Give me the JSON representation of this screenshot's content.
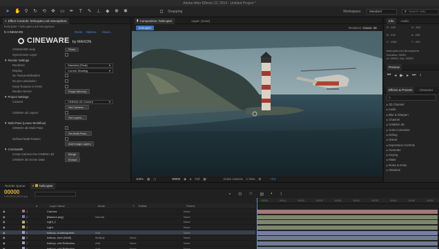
{
  "app": {
    "title": "Adobe After Effects CC 2014 - Untitled Project *"
  },
  "toolbar": {
    "tools": [
      "selection-tool-icon",
      "hand-tool-icon",
      "zoom-tool-icon",
      "rotate-tool-icon",
      "camera-orbit-icon",
      "pan-behind-icon",
      "rectangle-tool-icon",
      "pen-tool-icon",
      "text-tool-icon",
      "brush-tool-icon",
      "clone-stamp-icon",
      "eraser-tool-icon",
      "roto-brush-icon",
      "puppet-pin-icon"
    ],
    "snapping_label": "Snapping",
    "workspace_label": "Workspace:",
    "workspace_value": "Standard",
    "search_placeholder": "Search Help"
  },
  "effects_panel": {
    "tab_label": "Effect Controls: helicopter.c4d Atmosphere",
    "breadcrumb": "helicopter • helicopter.c4d Atmosphere",
    "effect_name": "fx CINEWARE",
    "reset_label": "Reset",
    "options_label": "Options...",
    "about_label": "About...",
    "logo_text": "CINEWARE",
    "logo_by": "by MAXON",
    "rows": [
      {
        "label": "CINEWARE Help",
        "control": "button",
        "value": "Show"
      },
      {
        "label": "Synchronize Layer",
        "control": "check",
        "value": ""
      },
      {
        "label": "▼ Render Settings",
        "control": "none",
        "value": ""
      },
      {
        "label": "Renderer",
        "control": "dropdown",
        "value": "Standard (Final)"
      },
      {
        "label": "Display",
        "control": "dropdown",
        "value": "Current Shading"
      },
      {
        "label": "No Textures/Shaders",
        "control": "check",
        "value": ""
      },
      {
        "label": "No pre-calculation",
        "control": "check",
        "value": ""
      },
      {
        "label": "Keep Textures in RAM",
        "control": "check",
        "value": ""
      },
      {
        "label": "Render Server",
        "control": "button",
        "value": "Purge Memory"
      },
      {
        "label": "▼ Project Settings",
        "control": "none",
        "value": ""
      },
      {
        "label": "Camera",
        "control": "dropdown",
        "value": "CINEMA 4D Camera"
      },
      {
        "label": "",
        "control": "button",
        "value": "Set Camera..."
      },
      {
        "label": "CINEMA 4D Layers",
        "control": "check",
        "value": ""
      },
      {
        "label": "",
        "control": "button",
        "value": "Set Layers..."
      },
      {
        "label": "▼ Multi-Pass (Linear Workflow)",
        "control": "none",
        "value": ""
      },
      {
        "label": "CINEMA 4D Multi-Pass",
        "control": "check",
        "value": ""
      },
      {
        "label": "",
        "control": "button",
        "value": "Set Multi-Pass..."
      },
      {
        "label": "Defined Multi-Passes",
        "control": "check",
        "value": ""
      },
      {
        "label": "",
        "control": "button",
        "value": "Add Image Layers"
      },
      {
        "label": "▼ Commands",
        "control": "none",
        "value": ""
      },
      {
        "label": "Comp Camera into CINEMA 4D",
        "control": "button",
        "value": "Merge"
      },
      {
        "label": "CINEMA 4D Scene Data",
        "control": "button",
        "value": "Extract"
      }
    ]
  },
  "comp_panel": {
    "tab_label": "Composition: helicopter",
    "layer_tab_label": "Layer: (none)",
    "comp_name": "helicopter",
    "renderer_label": "Renderer:",
    "renderer_value": "Classic 3D",
    "zoom": "100%",
    "timecode": "00000",
    "quality": "Full",
    "view_camera": "Active Camera",
    "view_count": "1 View",
    "exposure": "+0.0"
  },
  "right_panel": {
    "info_tab": "Info",
    "audio_tab": "Audio",
    "info_lines": [
      "R : 200",
      "G : 204",
      "B : 216",
      "A : 255",
      "X : 1156",
      "Y : 442"
    ],
    "layer_lines": [
      "helicopter.c4d Atmosphere",
      "Duration: 00051",
      "In: 00000, Out: 00050"
    ],
    "preview_tab": "Preview",
    "effects_tab": "Effects & Presets",
    "character_tab": "Character",
    "effects_list": [
      "▸ 3D Channel",
      "▸ Audio",
      "▸ Blur & Sharpen",
      "▸ Channel",
      "▸ CINEMA 4D",
      "▸ Color Correction",
      "▸ Debug",
      "▸ Distort",
      "▸ Expression Controls",
      "▸ Generate",
      "▸ Keying",
      "▸ Matte",
      "▸ Noise & Grain",
      "▸ Obsolete"
    ]
  },
  "timeline": {
    "render_queue_tab": "Render Queue",
    "comp_tab": "helicopter",
    "timecode": "00000",
    "timecode_sub": "0:00:00:00 (25.00 fps)",
    "columns": [
      "#",
      "Layer Name",
      "Mode",
      "T",
      "TrkMat",
      "Parent"
    ],
    "layers": [
      {
        "num": "1",
        "name": "Camera",
        "mode": "",
        "trkmat": "",
        "parent": "None",
        "color": "#b07070"
      },
      {
        "num": "2",
        "name": "[Basmor.png]",
        "mode": "Normal",
        "trkmat": "",
        "parent": "None",
        "color": "#7080b0"
      },
      {
        "num": "3",
        "name": "Light_1",
        "mode": "",
        "trkmat": "",
        "parent": "None",
        "color": "#c0b060"
      },
      {
        "num": "4",
        "name": "Light",
        "mode": "",
        "trkmat": "",
        "parent": "None",
        "color": "#c0b060"
      },
      {
        "num": "5",
        "name": "helicop..d Atmosphere",
        "mode": "Add",
        "trkmat": "",
        "parent": "None",
        "color": "#a0a0c0"
      },
      {
        "num": "6",
        "name": "helicop..here (Multi)",
        "mode": "Multiply",
        "trkmat": "None",
        "parent": "None",
        "color": "#a0a0c0"
      },
      {
        "num": "7",
        "name": "helicop..c4d Reflection",
        "mode": "Add",
        "trkmat": "None",
        "parent": "None",
        "color": "#a0a0c0"
      },
      {
        "num": "8",
        "name": "helicop..c4d Reflection",
        "mode": "Add",
        "trkmat": "None",
        "parent": "None",
        "color": "#a0a0c0"
      }
    ],
    "ruler_ticks": [
      "00005",
      "00010",
      "00015",
      "00020",
      "00025",
      "00030",
      "00035",
      "00040",
      "00045",
      "00050"
    ]
  }
}
